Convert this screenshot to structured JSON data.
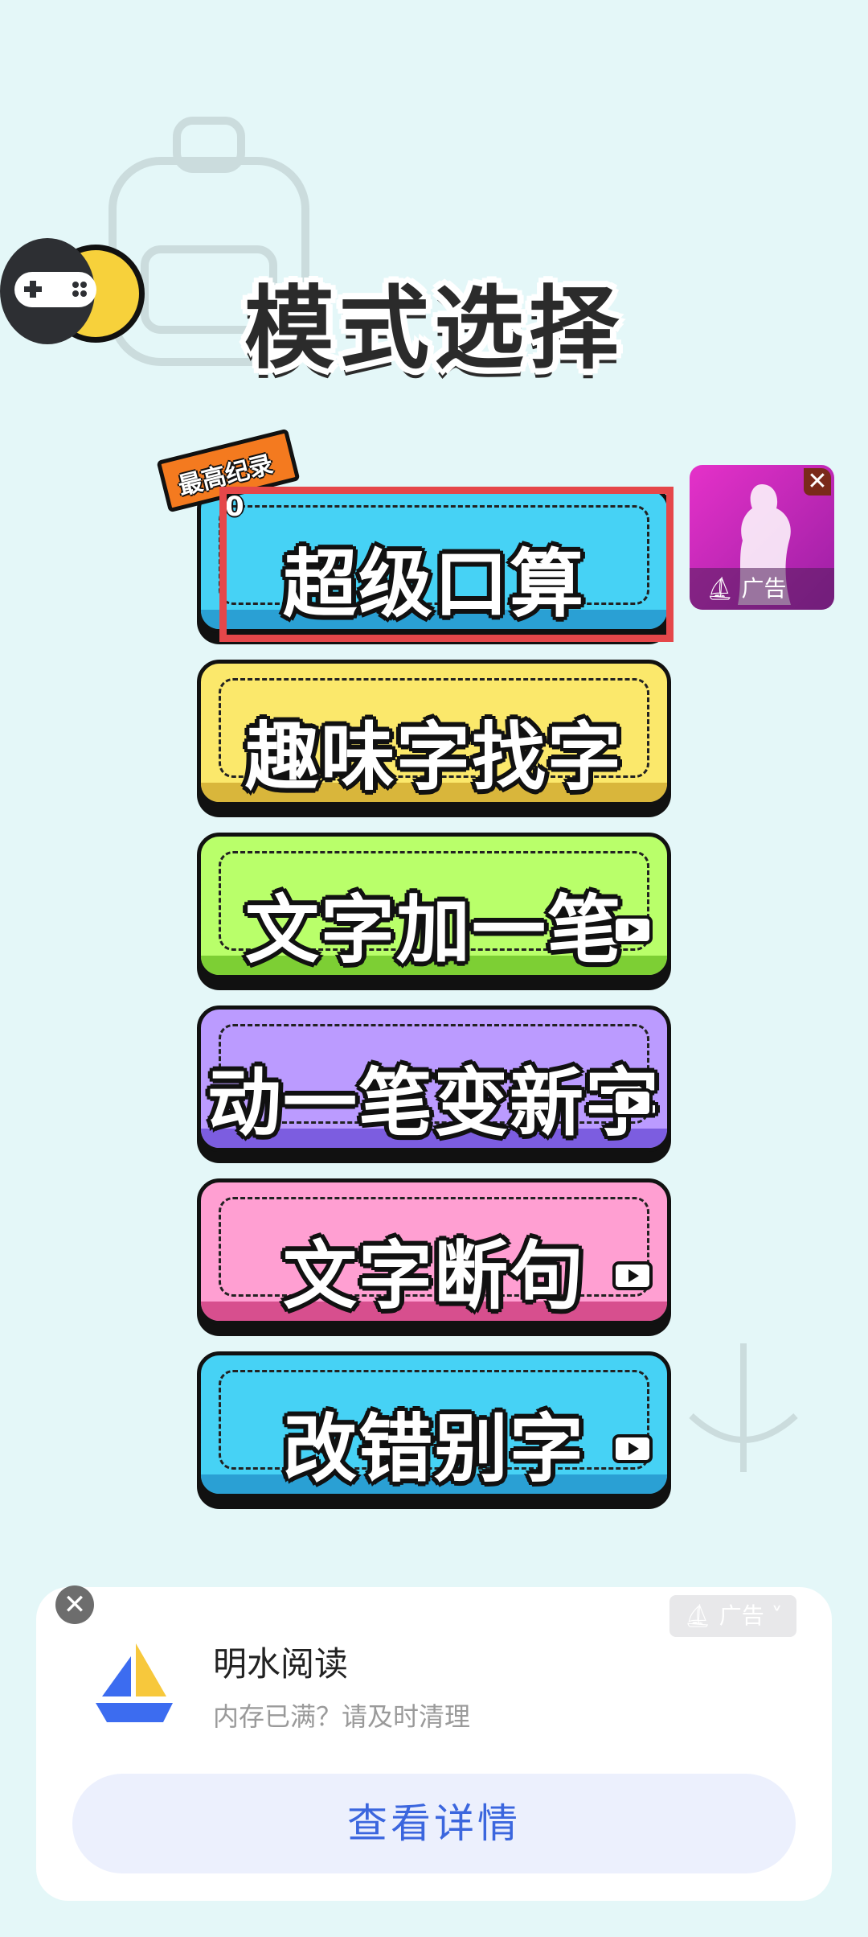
{
  "title": "模式选择",
  "record": {
    "label": "最高纪录",
    "score": "0"
  },
  "modes": [
    {
      "label": "超级口算",
      "color": "#46d2f5",
      "dark": "#2aa0d4",
      "video": false
    },
    {
      "label": "趣味字找字",
      "color": "#fbe86b",
      "dark": "#d9b63b",
      "video": false
    },
    {
      "label": "文字加一笔",
      "color": "#b9ff6a",
      "dark": "#7dcf34",
      "video": true
    },
    {
      "label": "动一笔变新字",
      "color": "#bb9bff",
      "dark": "#7c5de0",
      "video": true
    },
    {
      "label": "文字断句",
      "color": "#ff9fd2",
      "dark": "#d74f8e",
      "video": true
    },
    {
      "label": "改错别字",
      "color": "#46d2f5",
      "dark": "#2aa0d4",
      "video": true
    }
  ],
  "side_ad": {
    "close": "✕",
    "label": "广告"
  },
  "ad_card": {
    "badge": "广告",
    "app_name": "明水阅读",
    "description": "内存已满？请及时清理",
    "cta": "查看详情",
    "close": "✕"
  }
}
